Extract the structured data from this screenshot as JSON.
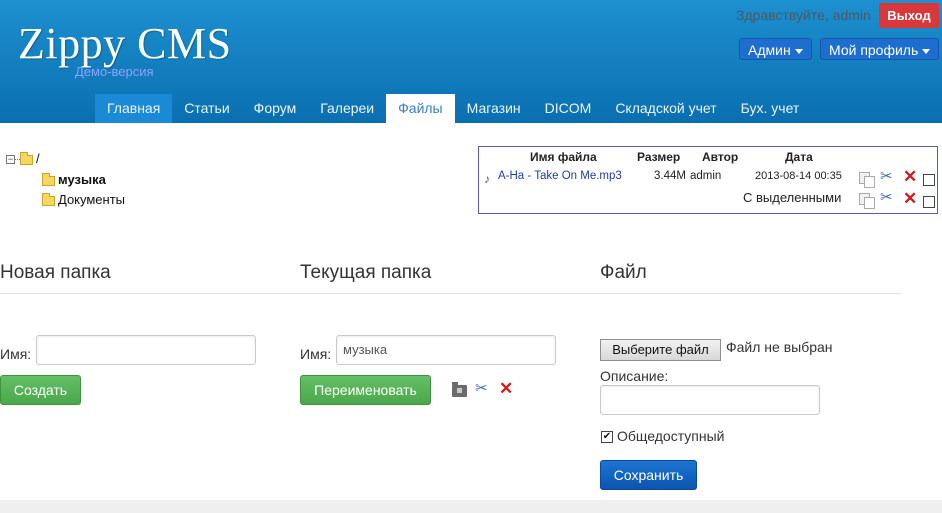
{
  "header": {
    "brand": "Zippy CMS",
    "subtitle": "Демо-версия",
    "greeting": "Здравствуйте, admin",
    "logout_label": "Выход",
    "admin_menu": "Админ",
    "profile_menu": "Мой профиль"
  },
  "nav": {
    "items": [
      "Главная",
      "Статьи",
      "Форум",
      "Галереи",
      "Файлы",
      "Магазин",
      "DICOM",
      "Складской учет",
      "Бух. учет"
    ],
    "active": "Файлы"
  },
  "tree": {
    "root": "/",
    "expander": "−",
    "folders": [
      "музыка",
      "Документы"
    ]
  },
  "files_table": {
    "columns": [
      "Имя файла",
      "Размер",
      "Автор",
      "Дата"
    ],
    "rows": [
      {
        "name": "A-Ha - Take On Me.mp3",
        "size": "3.44M",
        "author": "admin",
        "date": "2013-08-14 00:35"
      }
    ],
    "with_selected": "С выделенными"
  },
  "new_folder": {
    "title": "Новая папка",
    "name_label": "Имя:",
    "name_value": "",
    "create_button": "Создать"
  },
  "current_folder": {
    "title": "Текущая папка",
    "name_label": "Имя:",
    "name_value": "музыка",
    "rename_button": "Переименовать"
  },
  "file_upload": {
    "title": "Файл",
    "choose_button": "Выберите файл",
    "no_file": "Файл не выбран",
    "description_label": "Описание:",
    "description_value": "",
    "public_label": "Общедоступный",
    "public_checked": true,
    "save_button": "Сохранить"
  },
  "colors": {
    "header": "#1283c6",
    "logout": "#d9383a",
    "green_button": "#52b152",
    "blue_button": "#1066c3",
    "delete_icon": "#d21a1a"
  }
}
